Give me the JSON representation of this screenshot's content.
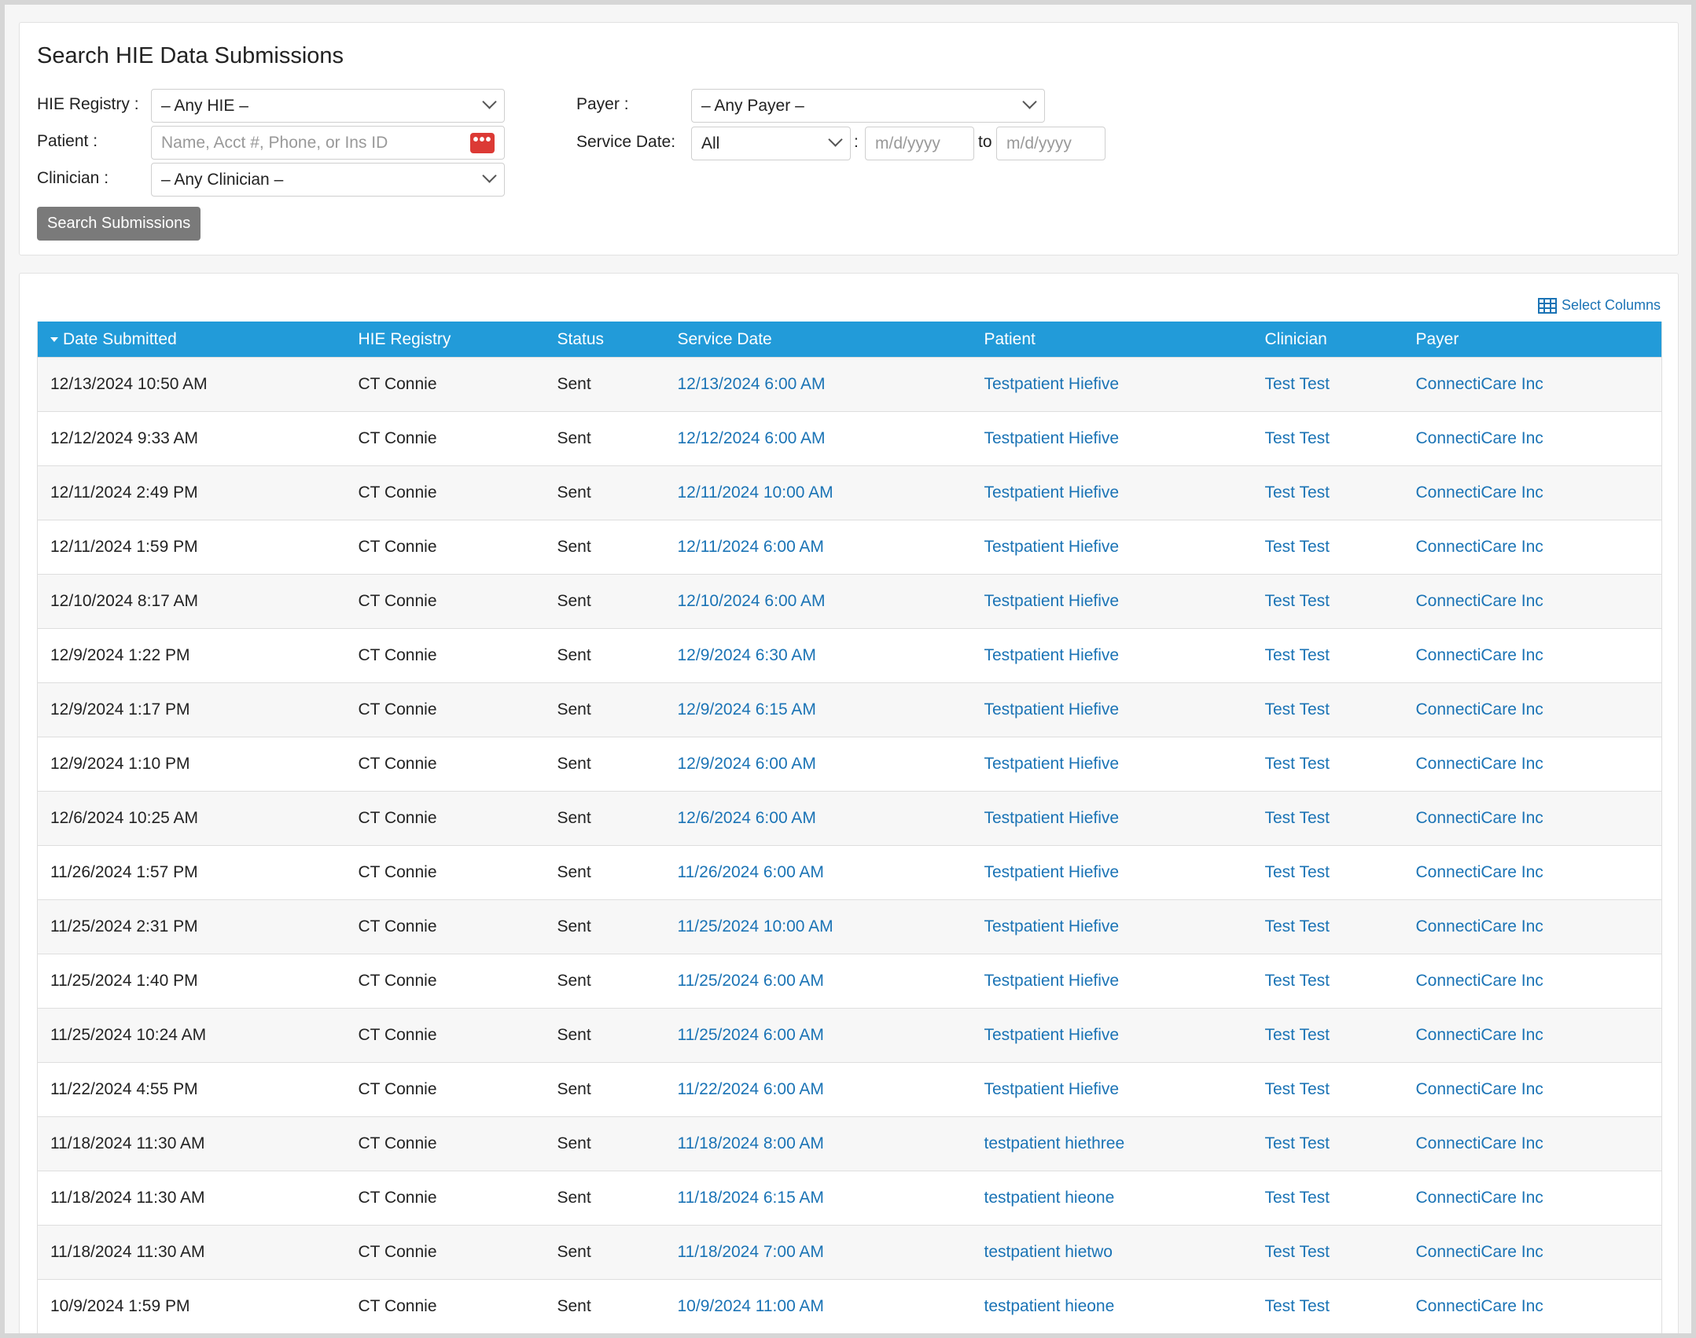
{
  "search": {
    "title": "Search HIE Data Submissions",
    "hie_label": "HIE Registry :",
    "hie_value": "– Any HIE –",
    "patient_label": "Patient :",
    "patient_placeholder": "Name, Acct #, Phone, or Ins ID",
    "clinician_label": "Clinician :",
    "clinician_value": "– Any Clinician –",
    "payer_label": "Payer :",
    "payer_value": "– Any Payer –",
    "service_date_label": "Service Date:",
    "service_date_range": "All",
    "colon": ":",
    "from_placeholder": "m/d/yyyy",
    "to_label": "to",
    "to_placeholder": "m/d/yyyy",
    "button_label": "Search Submissions"
  },
  "results": {
    "select_columns_label": "Select Columns",
    "columns": [
      "Date Submitted",
      "HIE Registry",
      "Status",
      "Service Date",
      "Patient",
      "Clinician",
      "Payer"
    ],
    "rows": [
      [
        "12/13/2024 10:50 AM",
        "CT Connie",
        "Sent",
        "12/13/2024 6:00 AM",
        "Testpatient Hiefive",
        "Test Test",
        "ConnectiCare Inc"
      ],
      [
        "12/12/2024 9:33 AM",
        "CT Connie",
        "Sent",
        "12/12/2024 6:00 AM",
        "Testpatient Hiefive",
        "Test Test",
        "ConnectiCare Inc"
      ],
      [
        "12/11/2024 2:49 PM",
        "CT Connie",
        "Sent",
        "12/11/2024 10:00 AM",
        "Testpatient Hiefive",
        "Test Test",
        "ConnectiCare Inc"
      ],
      [
        "12/11/2024 1:59 PM",
        "CT Connie",
        "Sent",
        "12/11/2024 6:00 AM",
        "Testpatient Hiefive",
        "Test Test",
        "ConnectiCare Inc"
      ],
      [
        "12/10/2024 8:17 AM",
        "CT Connie",
        "Sent",
        "12/10/2024 6:00 AM",
        "Testpatient Hiefive",
        "Test Test",
        "ConnectiCare Inc"
      ],
      [
        "12/9/2024 1:22 PM",
        "CT Connie",
        "Sent",
        "12/9/2024 6:30 AM",
        "Testpatient Hiefive",
        "Test Test",
        "ConnectiCare Inc"
      ],
      [
        "12/9/2024 1:17 PM",
        "CT Connie",
        "Sent",
        "12/9/2024 6:15 AM",
        "Testpatient Hiefive",
        "Test Test",
        "ConnectiCare Inc"
      ],
      [
        "12/9/2024 1:10 PM",
        "CT Connie",
        "Sent",
        "12/9/2024 6:00 AM",
        "Testpatient Hiefive",
        "Test Test",
        "ConnectiCare Inc"
      ],
      [
        "12/6/2024 10:25 AM",
        "CT Connie",
        "Sent",
        "12/6/2024 6:00 AM",
        "Testpatient Hiefive",
        "Test Test",
        "ConnectiCare Inc"
      ],
      [
        "11/26/2024 1:57 PM",
        "CT Connie",
        "Sent",
        "11/26/2024 6:00 AM",
        "Testpatient Hiefive",
        "Test Test",
        "ConnectiCare Inc"
      ],
      [
        "11/25/2024 2:31 PM",
        "CT Connie",
        "Sent",
        "11/25/2024 10:00 AM",
        "Testpatient Hiefive",
        "Test Test",
        "ConnectiCare Inc"
      ],
      [
        "11/25/2024 1:40 PM",
        "CT Connie",
        "Sent",
        "11/25/2024 6:00 AM",
        "Testpatient Hiefive",
        "Test Test",
        "ConnectiCare Inc"
      ],
      [
        "11/25/2024 10:24 AM",
        "CT Connie",
        "Sent",
        "11/25/2024 6:00 AM",
        "Testpatient Hiefive",
        "Test Test",
        "ConnectiCare Inc"
      ],
      [
        "11/22/2024 4:55 PM",
        "CT Connie",
        "Sent",
        "11/22/2024 6:00 AM",
        "Testpatient Hiefive",
        "Test Test",
        "ConnectiCare Inc"
      ],
      [
        "11/18/2024 11:30 AM",
        "CT Connie",
        "Sent",
        "11/18/2024 8:00 AM",
        "testpatient hiethree",
        "Test Test",
        "ConnectiCare Inc"
      ],
      [
        "11/18/2024 11:30 AM",
        "CT Connie",
        "Sent",
        "11/18/2024 6:15 AM",
        "testpatient hieone",
        "Test Test",
        "ConnectiCare Inc"
      ],
      [
        "11/18/2024 11:30 AM",
        "CT Connie",
        "Sent",
        "11/18/2024 7:00 AM",
        "testpatient hietwo",
        "Test Test",
        "ConnectiCare Inc"
      ],
      [
        "10/9/2024 1:59 PM",
        "CT Connie",
        "Sent",
        "10/9/2024 11:00 AM",
        "testpatient hieone",
        "Test Test",
        "ConnectiCare Inc"
      ]
    ]
  },
  "colors": {
    "header_bg": "#229bd9",
    "link": "#1a73b5",
    "button_bg": "#7a7a7a",
    "alert": "#dc3a35"
  },
  "icons": {
    "dropdown": "chevron-down-icon",
    "patient_lookup": "more-dots-icon",
    "select_columns": "table-grid-icon",
    "sort": "sort-desc-icon"
  }
}
